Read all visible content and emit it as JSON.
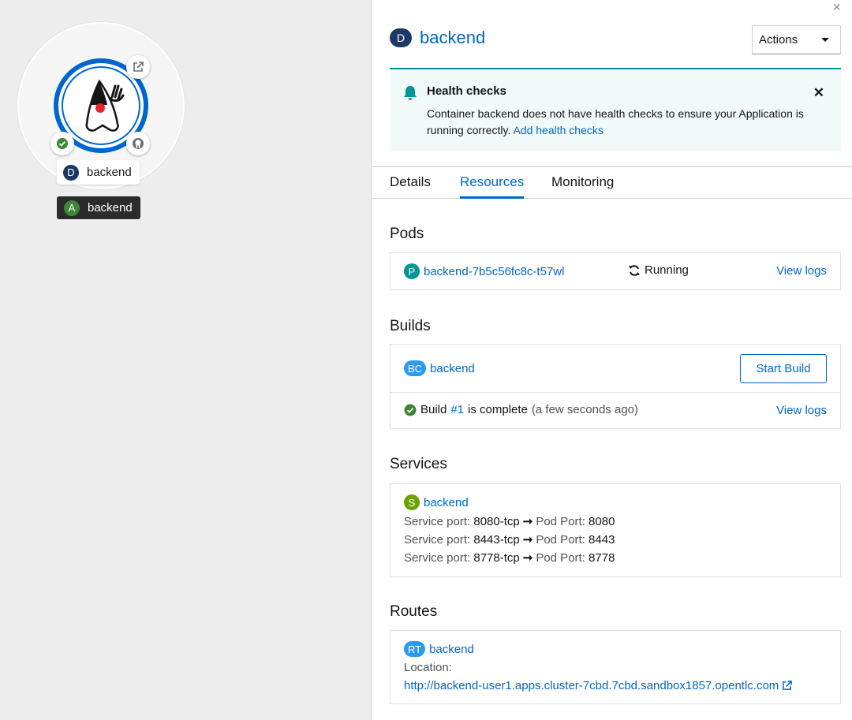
{
  "canvas": {
    "node_kind_badge": "D",
    "node_name": "backend",
    "app_badge": "A",
    "app_name": "backend"
  },
  "panel": {
    "close": "×",
    "kind_badge": "D",
    "title": "backend",
    "actions_label": "Actions",
    "alert": {
      "title": "Health checks",
      "body": "Container backend does not have health checks to ensure your Application is running correctly.",
      "link": "Add health checks",
      "close": "✕"
    },
    "tabs": [
      "Details",
      "Resources",
      "Monitoring"
    ],
    "pods": {
      "heading": "Pods",
      "badge": "P",
      "name": "backend-7b5c56fc8c-t57wl",
      "status": "Running",
      "logs": "View logs"
    },
    "builds": {
      "heading": "Builds",
      "badge": "BC",
      "name": "backend",
      "start_button": "Start Build",
      "build_prefix": "Build",
      "build_number": "#1",
      "build_status": "is complete",
      "build_time": "(a few seconds ago)",
      "logs": "View logs"
    },
    "services": {
      "heading": "Services",
      "badge": "S",
      "name": "backend",
      "ports": [
        {
          "service_label": "Service port:",
          "service": "8080-tcp",
          "pod_label": "Pod Port:",
          "pod": "8080"
        },
        {
          "service_label": "Service port:",
          "service": "8443-tcp",
          "pod_label": "Pod Port:",
          "pod": "8443"
        },
        {
          "service_label": "Service port:",
          "service": "8778-tcp",
          "pod_label": "Pod Port:",
          "pod": "8778"
        }
      ]
    },
    "routes": {
      "heading": "Routes",
      "badge": "RT",
      "name": "backend",
      "location_label": "Location:",
      "url": "http://backend-user1.apps.cluster-7cbd.7cbd.sandbox1857.opentlc.com"
    }
  },
  "colors": {
    "link": "#0066cc",
    "alert_accent": "#009596",
    "success": "#3e8635",
    "deployment_badge": "#1c3966"
  }
}
